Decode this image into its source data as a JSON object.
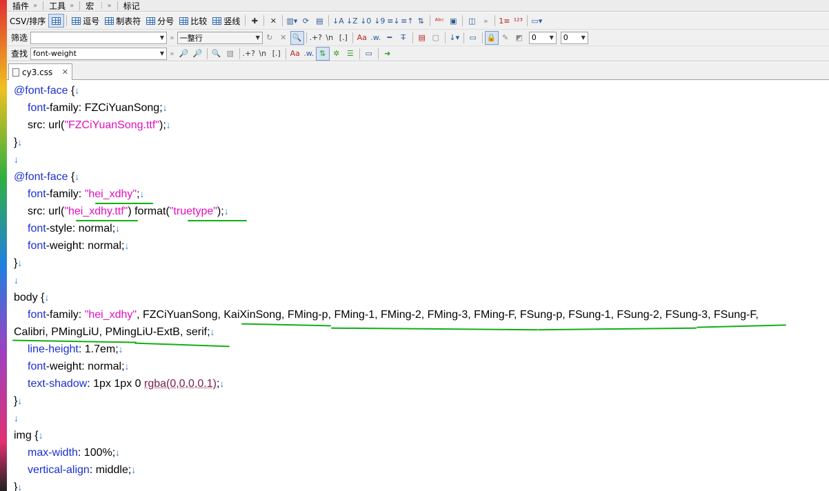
{
  "menu": {
    "plugins": "插件",
    "tools": "工具",
    "macros": "宏",
    "bookmarks": "标记"
  },
  "toolbar1": {
    "csv": "CSV/排序",
    "comma": "逗号",
    "tab": "制表符",
    "semicolon": "分号",
    "compare": "比较",
    "pipe": "竖线"
  },
  "filter": {
    "label": "筛选",
    "value": "",
    "mode": "一整行"
  },
  "find": {
    "label": "查找",
    "value": "font-weight"
  },
  "number_combos": [
    "0",
    "0"
  ],
  "tab": {
    "filename": "cy3.css"
  },
  "code": {
    "l1_at": "@font-face",
    "l1_rest": " {",
    "l2_prop": "font",
    "l2_prop2": "-family: FZCiYuanSong;",
    "l3_a": "src: url(",
    "l3_str": "\"FZCiYuanSong.ttf\"",
    "l3_b": ");",
    "l4": "}",
    "l6_at": "@font-face",
    "l6_rest": " {",
    "l7_prop": "font",
    "l7_a": "-family: ",
    "l7_str": "\"hei_xdhy\"",
    "l7_b": ";",
    "l8_a": "src: url(",
    "l8_str": "\"hei_xdhy.ttf\"",
    "l8_b": ") format(",
    "l8_str2": "\"truetype\"",
    "l8_c": ");",
    "l9_prop": "font",
    "l9_a": "-style: normal;",
    "l10_prop": "font",
    "l10_a": "-weight: normal;",
    "l11": "}",
    "l13": "body {",
    "l14_prop": "font",
    "l14_a": "-family: ",
    "l14_str": "\"hei_xdhy\"",
    "l14_b": ", FZCiYuanSong, KaiXinSong, FMing-p, FMing-1, FMing-2, FMing-3, FMing-F, FSung-p, FSung-1, FSung-2, FSung-3, FSung-F,",
    "l15": "Calibri, PMingLiU, PMingLiU-ExtB, serif;",
    "l16_prop": "line-height",
    "l16_a": ": 1.7em;",
    "l17_prop": "font",
    "l17_a": "-weight: normal;",
    "l18_prop": "text-shadow",
    "l18_a": ": 1px 1px 0 ",
    "l18_fn": "rgba(0,0,0,0.1)",
    "l18_b": ";",
    "l19": "}",
    "l21": "img {",
    "l22_prop": "max-width",
    "l22_a": ": 100%;",
    "l23_prop": "vertical-align",
    "l23_a": ": middle;",
    "l24": "}"
  },
  "colors": {
    "keyword": "#1a2fd0",
    "string": "#e010c0",
    "underline": "#10b010",
    "eol_arrow": "#2a7ad8"
  }
}
